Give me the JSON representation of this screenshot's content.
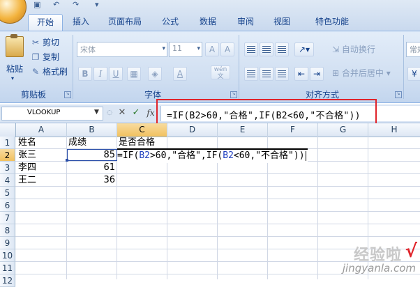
{
  "ribbon_tabs": [
    "开始",
    "插入",
    "页面布局",
    "公式",
    "数据",
    "审阅",
    "视图",
    "特色功能"
  ],
  "clipboard": {
    "paste": "粘贴",
    "cut": "剪切",
    "copy": "复制",
    "format_painter": "格式刷",
    "group_label": "剪贴板"
  },
  "font": {
    "name": "宋体",
    "size": "11",
    "group_label": "字体",
    "bold": "B",
    "italic": "I",
    "underline": "U",
    "phonetic": "wén"
  },
  "alignment": {
    "wrap_text": "自动换行",
    "merge_center": "合并后居中",
    "group_label": "对齐方式"
  },
  "number": {
    "format": "常规"
  },
  "formula_bar": {
    "name_box": "VLOOKUP",
    "cancel": "✕",
    "enter": "✓",
    "fx": "fx",
    "formula": "=IF(B2>60,\"合格\",IF(B2<60,\"不合格\"))"
  },
  "columns": [
    "A",
    "B",
    "C",
    "D",
    "E",
    "F",
    "G",
    "H"
  ],
  "rows": [
    "1",
    "2",
    "3",
    "4",
    "5",
    "6",
    "7",
    "8",
    "9",
    "10",
    "11",
    "12"
  ],
  "cells": {
    "A1": "姓名",
    "B1": "成绩",
    "C1": "是否合格",
    "A2": "张三",
    "B2": "85",
    "A3": "李四",
    "B3": "61",
    "A4": "王二",
    "B4": "36"
  },
  "cell_edit": {
    "part1": "=IF(",
    "ref1": "B2",
    "part2": ">60,\"合格\",IF(",
    "ref2": "B2",
    "part3": "<60,\"不合格\"))"
  },
  "watermark": {
    "text": "经验啦",
    "check": "√",
    "url": "jingyanla.com"
  },
  "colors": {
    "highlight_box": "#e0242b",
    "active_header": "#f1c15f",
    "reference": "#1f3fbf"
  }
}
